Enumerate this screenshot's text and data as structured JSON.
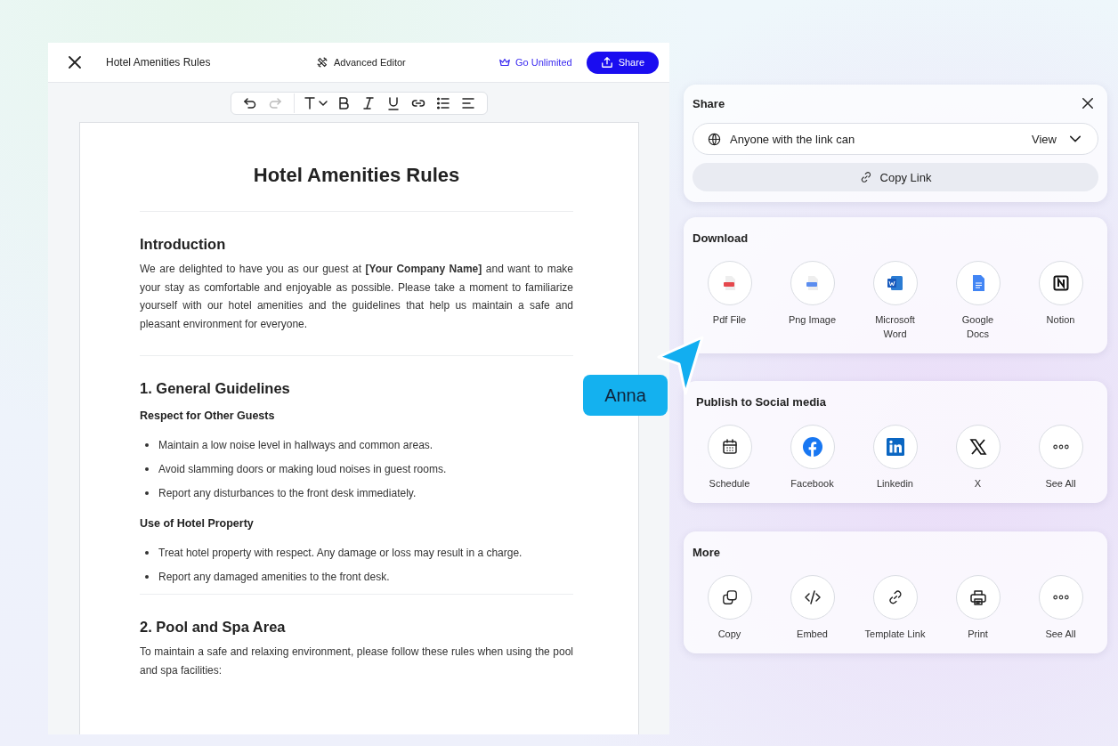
{
  "header": {
    "title": "Hotel Amenities Rules",
    "advanced_editor": "Advanced Editor",
    "go_unlimited": "Go Unlimited",
    "share_button": "Share"
  },
  "toolbar": [
    {
      "kind": "undo",
      "disabled": false
    },
    {
      "kind": "redo",
      "disabled": true
    },
    {
      "kind": "divider"
    },
    {
      "kind": "text-style",
      "disabled": false
    },
    {
      "kind": "bold",
      "disabled": false
    },
    {
      "kind": "italic",
      "disabled": false
    },
    {
      "kind": "underline",
      "disabled": false
    },
    {
      "kind": "link",
      "disabled": false
    },
    {
      "kind": "bullets",
      "disabled": false
    },
    {
      "kind": "align",
      "disabled": false
    }
  ],
  "document": {
    "title": "Hotel Amenities Rules",
    "blocks": [
      {
        "kind": "divider"
      },
      {
        "kind": "heading",
        "text": "Introduction"
      },
      {
        "kind": "paragraph",
        "text": "We are delighted to have you as our guest at **[Your Company Name]** and want to make your stay as comfortable and enjoyable as possible. Please take a moment to familiarize yourself with our hotel amenities and the guidelines that help us maintain a safe and pleasant environment for everyone."
      },
      {
        "kind": "divider"
      },
      {
        "kind": "heading",
        "text": "1. General Guidelines"
      },
      {
        "kind": "subheading",
        "text": "Respect for Other Guests"
      },
      {
        "kind": "bullets",
        "items": [
          "Maintain a low noise level in hallways and common areas.",
          "Avoid slamming doors or making loud noises in guest rooms.",
          "Report any disturbances to the front desk immediately."
        ]
      },
      {
        "kind": "subheading",
        "text": "Use of Hotel Property"
      },
      {
        "kind": "bullets",
        "items": [
          "Treat hotel property with respect. Any damage or loss may result in a charge.",
          "Report any damaged amenities to the front desk."
        ]
      },
      {
        "kind": "divider"
      },
      {
        "kind": "heading",
        "text": "2. Pool and Spa Area"
      },
      {
        "kind": "paragraph",
        "text": "To maintain a safe and relaxing environment, please follow these rules when using the pool and spa facilities:"
      }
    ]
  },
  "share_panel": {
    "title": "Share",
    "access_label": "Anyone with the link can",
    "permission": "View",
    "copy_link": "Copy Link"
  },
  "sections": [
    {
      "title": "Download",
      "items": [
        {
          "kind": "pdf",
          "label": "Pdf File"
        },
        {
          "kind": "png",
          "label": "Png Image"
        },
        {
          "kind": "word",
          "label": "Microsoft Word"
        },
        {
          "kind": "gdocs",
          "label": "Google Docs"
        },
        {
          "kind": "notion",
          "label": "Notion"
        }
      ]
    },
    {
      "title": "Publish to Social media",
      "items": [
        {
          "kind": "schedule",
          "label": "Schedule"
        },
        {
          "kind": "facebook",
          "label": "Facebook"
        },
        {
          "kind": "linkedin",
          "label": "Linkedin"
        },
        {
          "kind": "x",
          "label": "X"
        },
        {
          "kind": "more",
          "label": "See All"
        }
      ]
    },
    {
      "title": "More",
      "items": [
        {
          "kind": "copy",
          "label": "Copy"
        },
        {
          "kind": "embed",
          "label": "Embed"
        },
        {
          "kind": "link",
          "label": "Template Link"
        },
        {
          "kind": "print",
          "label": "Print"
        },
        {
          "kind": "more",
          "label": "See All"
        }
      ]
    }
  ],
  "cursor": {
    "name": "Anna"
  }
}
